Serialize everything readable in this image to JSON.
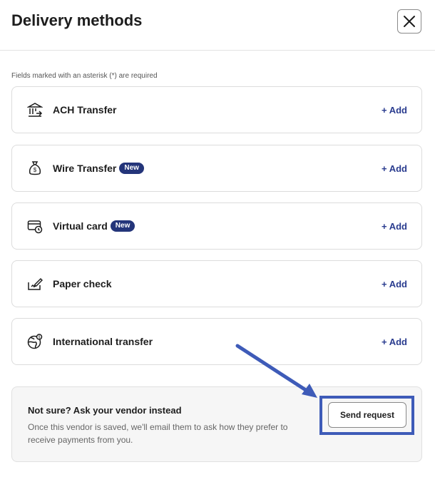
{
  "header": {
    "title": "Delivery methods",
    "close_icon": "close-icon"
  },
  "hint": "Fields marked with an asterisk (*) are required",
  "methods": [
    {
      "label": "ACH Transfer",
      "icon": "bank-icon",
      "badge": "",
      "action": "+ Add"
    },
    {
      "label": "Wire Transfer",
      "icon": "money-bag-icon",
      "badge": "New",
      "action": "+ Add"
    },
    {
      "label": "Virtual card",
      "icon": "card-clock-icon",
      "badge": "New",
      "action": "+ Add"
    },
    {
      "label": "Paper check",
      "icon": "check-pen-icon",
      "badge": "",
      "action": "+ Add"
    },
    {
      "label": "International transfer",
      "icon": "globe-icon",
      "badge": "",
      "action": "+ Add"
    }
  ],
  "vendor": {
    "title": "Not sure? Ask your vendor instead",
    "description": "Once this vendor is saved, we'll email them to ask how they prefer to receive payments from you.",
    "button": "Send request"
  },
  "colors": {
    "accent": "#2a3c8f",
    "badge": "#24357a",
    "annotation": "#3e5bb8"
  }
}
